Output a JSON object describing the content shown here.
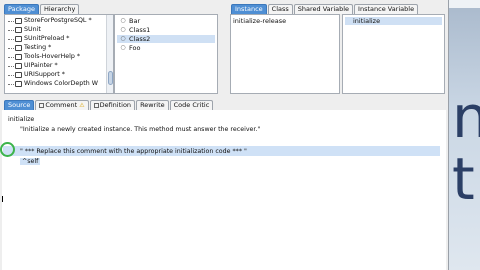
{
  "top_tabs": {
    "package": "Package",
    "hierarchy": "Hierarchy",
    "instance": "Instance",
    "class": "Class",
    "shared_variable": "Shared Variable",
    "instance_variable": "Instance Variable"
  },
  "packages": [
    "StoreForPostgreSQL *",
    "SUnit",
    "SUnitPreload *",
    "Testing *",
    "Tools-HoverHelp *",
    "UIPainter *",
    "URISupport *",
    "Windows ColorDepth W"
  ],
  "classes": [
    "Bar",
    "Class1",
    "Class2",
    "Foo"
  ],
  "selected_class": "Class2",
  "protocols": [
    "initialize-release"
  ],
  "methods": [
    "initialize"
  ],
  "code_tabs": {
    "source": "Source",
    "comment": "Comment",
    "definition": "Definition",
    "rewrite": "Rewrite",
    "code_critic": "Code Critic"
  },
  "code": {
    "line1": "initialize",
    "line2": "\"Initialize a newly created instance. This method must answer the receiver.\"",
    "line3": "\" *** Replace this comment with the appropriate initialization code *** \"",
    "line4": "^self"
  },
  "colors": {
    "accent": "#4f8fd4",
    "selection": "#cfe0f4",
    "ring": "#3cb44b"
  }
}
